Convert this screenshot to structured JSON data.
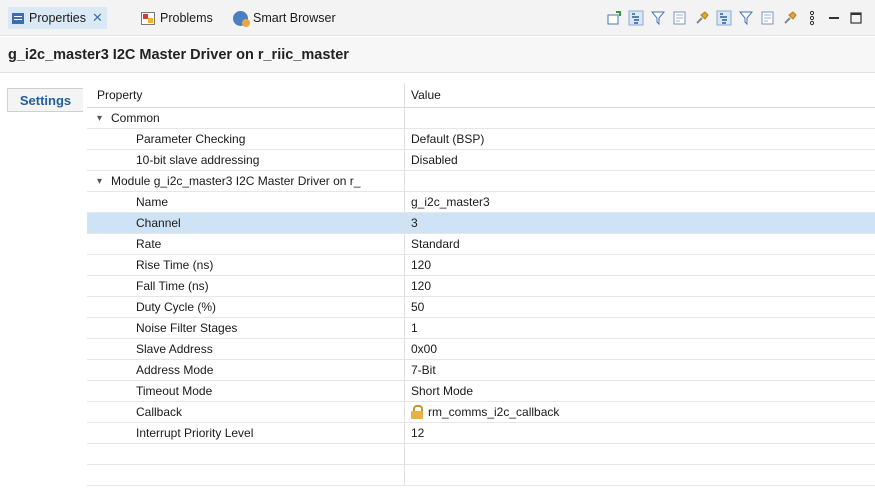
{
  "tabs": {
    "properties": "Properties",
    "problems": "Problems",
    "smart_browser": "Smart Browser"
  },
  "toolbar_icons": [
    "new-icon",
    "tree-icon",
    "filter-icon",
    "view-icon",
    "pin-icon",
    "tree-icon",
    "filter-icon",
    "view-icon",
    "pin-icon",
    "more-icon",
    "minimize-icon",
    "maximize-icon"
  ],
  "header": {
    "title": "g_i2c_master3 I2C Master Driver on r_riic_master"
  },
  "left_tab": {
    "label": "Settings"
  },
  "table": {
    "col_property": "Property",
    "col_value": "Value",
    "groups": [
      {
        "label": "Common",
        "rows": [
          {
            "name": "Parameter Checking",
            "value": "Default (BSP)"
          },
          {
            "name": "10-bit slave addressing",
            "value": "Disabled"
          }
        ]
      },
      {
        "label": "Module g_i2c_master3 I2C Master Driver on r_",
        "rows": [
          {
            "name": "Name",
            "value": "g_i2c_master3"
          },
          {
            "name": "Channel",
            "value": "3"
          },
          {
            "name": "Rate",
            "value": "Standard"
          },
          {
            "name": "Rise Time (ns)",
            "value": "120"
          },
          {
            "name": "Fall Time (ns)",
            "value": "120"
          },
          {
            "name": "Duty Cycle (%)",
            "value": "50"
          },
          {
            "name": "Noise Filter Stages",
            "value": "1"
          },
          {
            "name": "Slave Address",
            "value": "0x00"
          },
          {
            "name": "Address Mode",
            "value": "7-Bit"
          },
          {
            "name": "Timeout Mode",
            "value": "Short Mode"
          },
          {
            "name": "Callback",
            "value": "rm_comms_i2c_callback"
          },
          {
            "name": "Interrupt Priority Level",
            "value": "12"
          }
        ]
      }
    ]
  },
  "colors": {
    "selected_row": "#cfe3f6",
    "active_tab": "#dbe9f7",
    "settings_text": "#1f5f9f"
  }
}
